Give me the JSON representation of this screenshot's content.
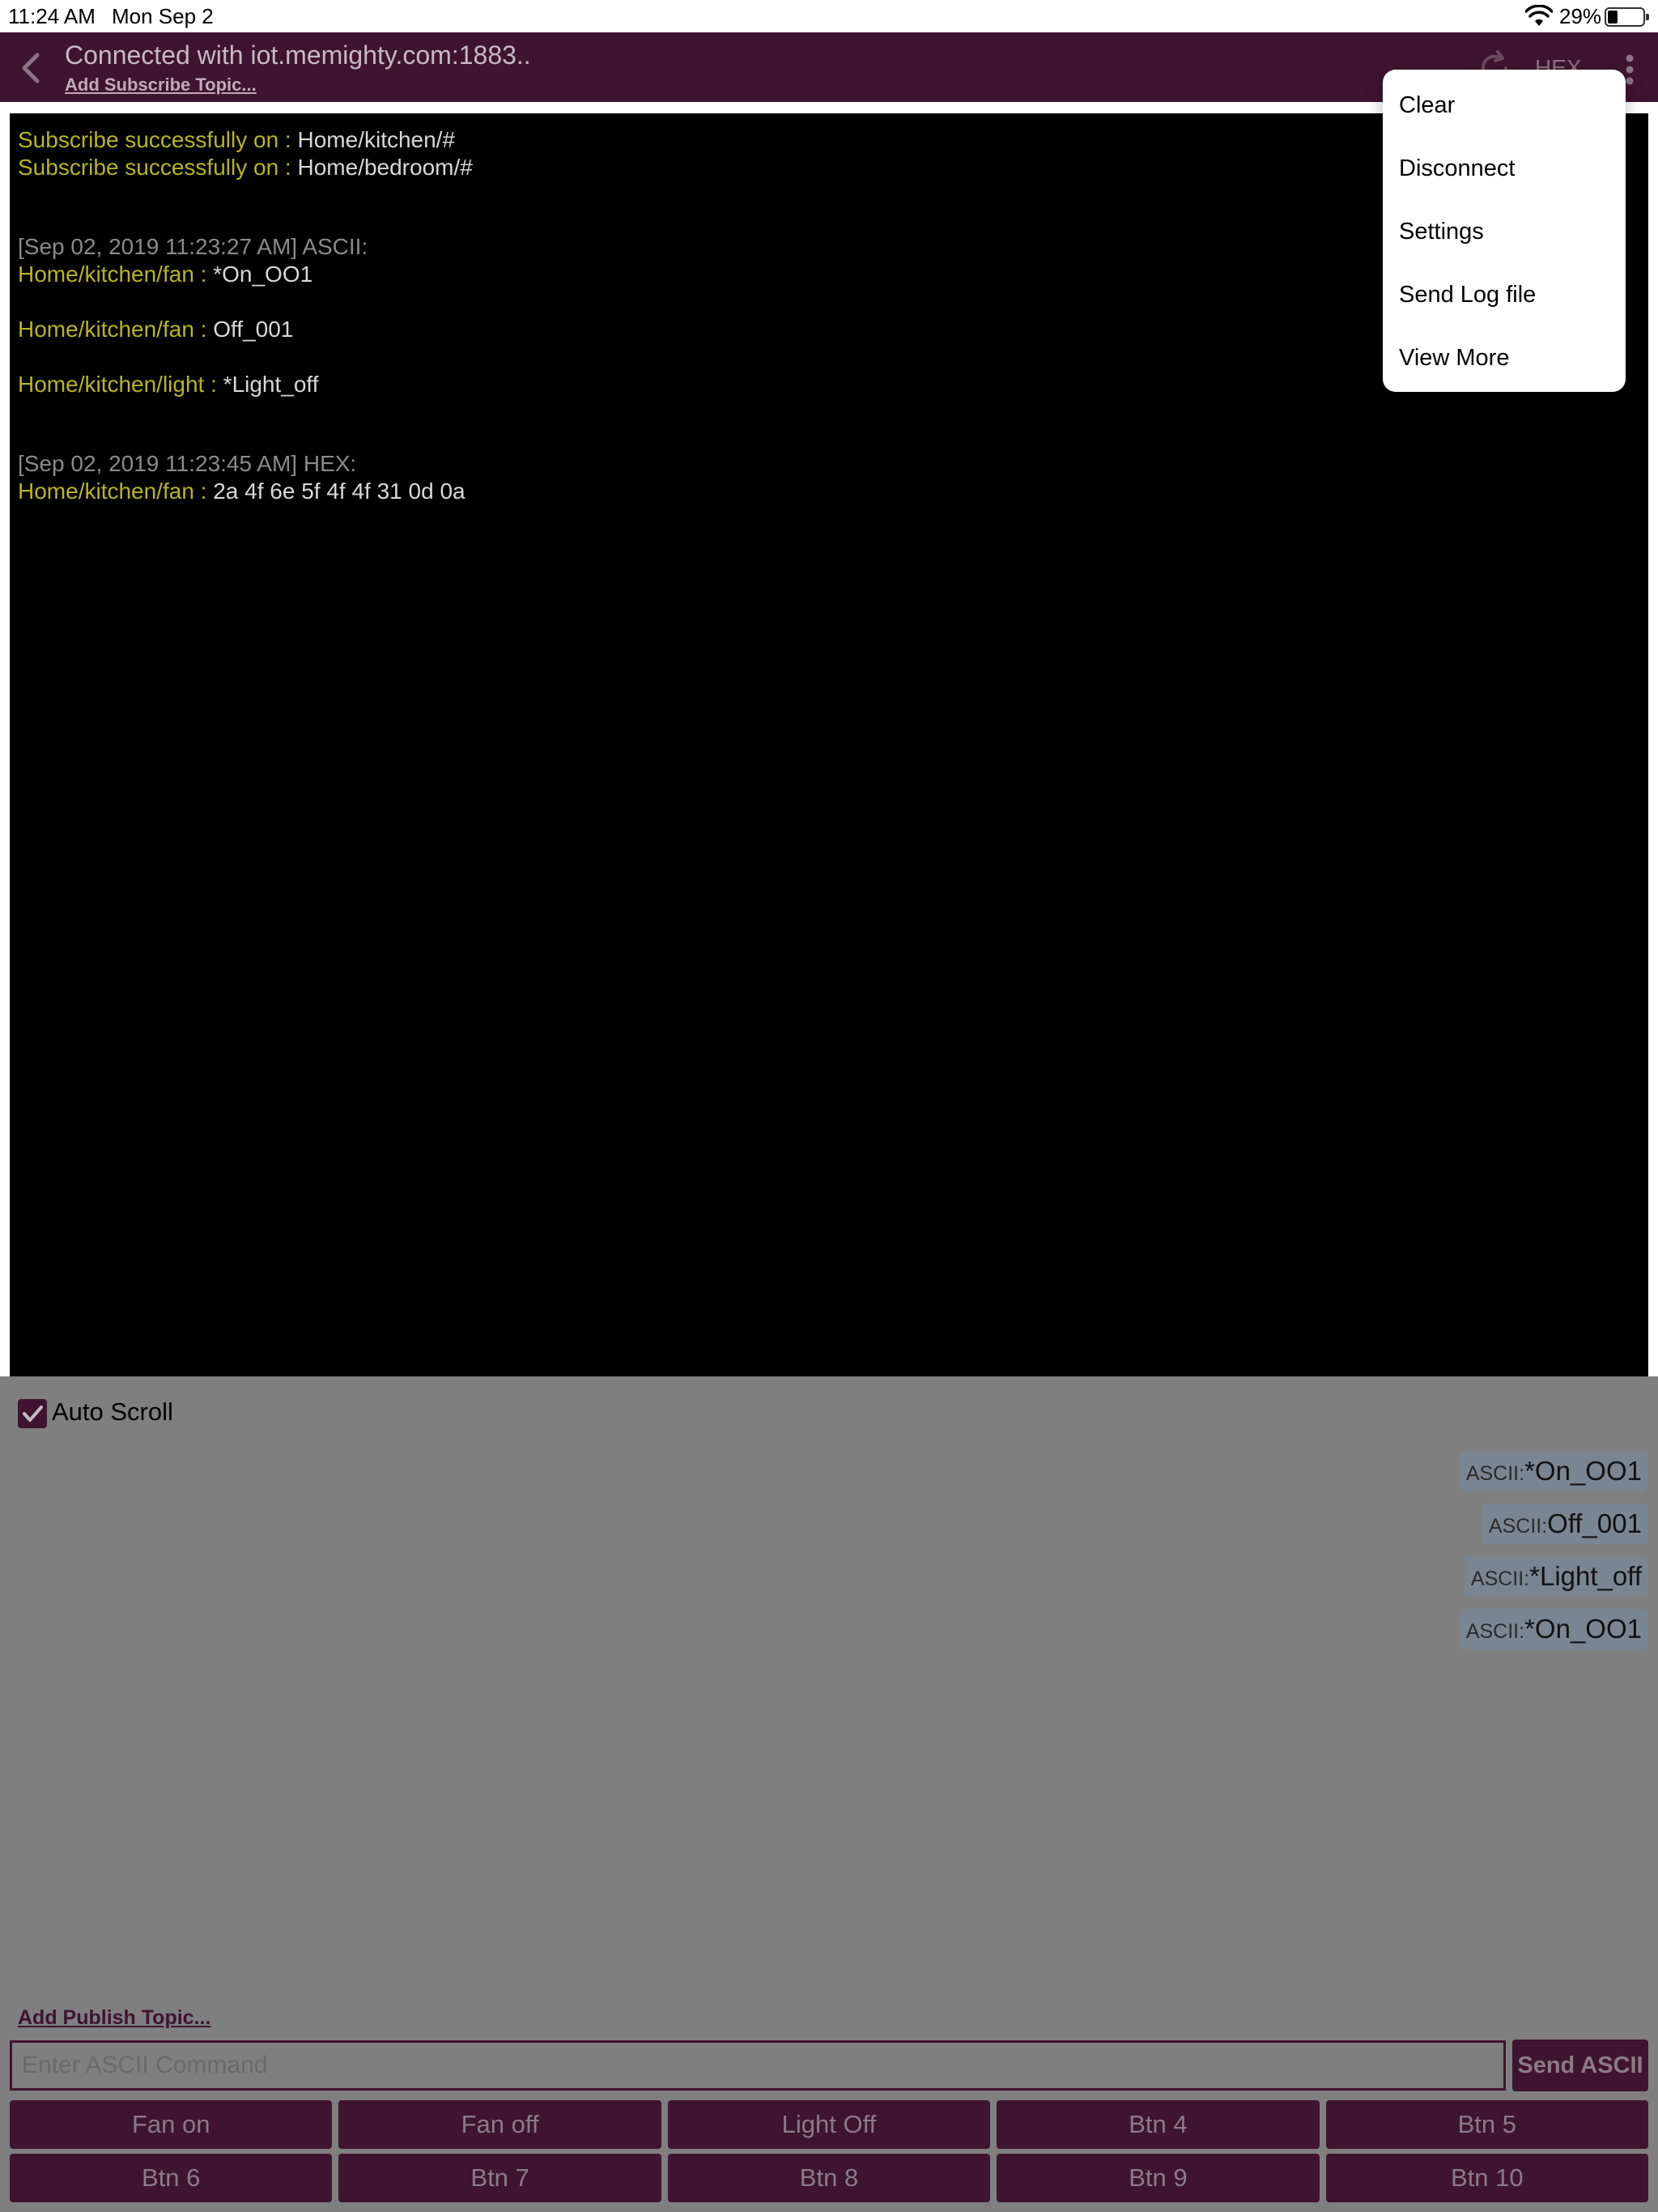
{
  "status_bar": {
    "time": "11:24 AM",
    "date": "Mon Sep 2",
    "battery": "29%"
  },
  "header": {
    "title": "Connected with iot.memighty.com:1883..",
    "subscribe_link": "Add Subscribe Topic...",
    "hex_label": "HEX"
  },
  "console": {
    "subscriptions": [
      {
        "label": "Subscribe successfully on :",
        "topic": "Home/kitchen/#"
      },
      {
        "label": "Subscribe successfully on :",
        "topic": "Home/bedroom/#"
      }
    ],
    "ascii_block": {
      "stamp": "[Sep 02, 2019 11:23:27 AM] ASCII:",
      "messages": [
        {
          "topic": "Home/kitchen/fan :",
          "payload": "*On_OO1"
        },
        {
          "topic": "Home/kitchen/fan :",
          "payload": "Off_001"
        },
        {
          "topic": "Home/kitchen/light :",
          "payload": "*Light_off"
        }
      ]
    },
    "hex_block": {
      "stamp": "[Sep 02, 2019 11:23:45 AM] HEX:",
      "messages": [
        {
          "topic": "Home/kitchen/fan :",
          "payload": "2a 4f 6e 5f 4f 4f 31 0d 0a"
        }
      ]
    }
  },
  "auto_scroll": {
    "label": "Auto Scroll",
    "checked": true
  },
  "history": [
    {
      "prefix": "ASCII:",
      "text": "*On_OO1"
    },
    {
      "prefix": "ASCII:",
      "text": "Off_001"
    },
    {
      "prefix": "ASCII:",
      "text": "*Light_off"
    },
    {
      "prefix": "ASCII:",
      "text": "*On_OO1"
    }
  ],
  "publish": {
    "add_topic": "Add Publish Topic...",
    "placeholder": "Enter ASCII Command",
    "send_label": "Send ASCII"
  },
  "buttons": [
    "Fan on",
    "Fan off",
    "Light Off",
    "Btn 4",
    "Btn 5",
    "Btn 6",
    "Btn 7",
    "Btn 8",
    "Btn 9",
    "Btn 10"
  ],
  "menu": [
    "Clear",
    "Disconnect",
    "Settings",
    "Send Log file",
    "View More"
  ],
  "colors": {
    "brand": "#3f1430",
    "console_bg": "#000000",
    "topic_text": "#b8b41f",
    "overlay_grey": "#7f7f7f",
    "chip_bg": "#7a8592"
  }
}
